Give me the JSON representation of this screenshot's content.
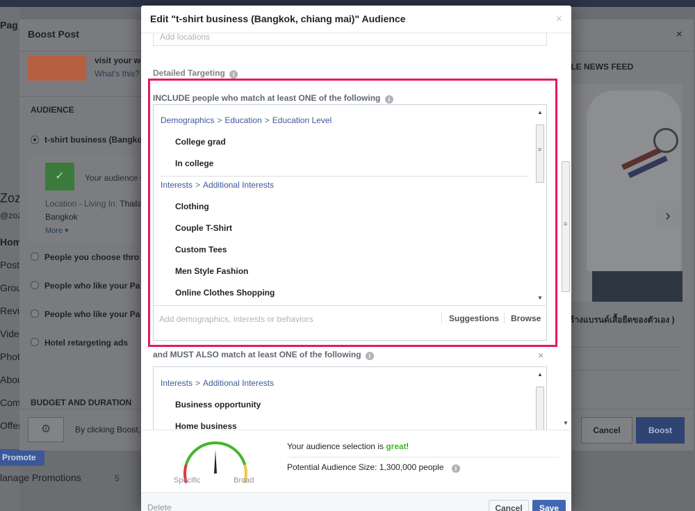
{
  "background": {
    "left_labels": [
      "Pag",
      "Zoza",
      "@zoz",
      "Hom",
      "Posts",
      "Grou",
      "Revie",
      "Video",
      "Photo",
      "Abou",
      "Comm",
      "Offer"
    ],
    "promote_label": "Promote",
    "manage_label": "lanage Promotions",
    "manage_count": "5"
  },
  "boost_post": {
    "title": "Boost Post",
    "close_icon": "×",
    "visit_text": "visit your we",
    "what_text": "What's this?",
    "audience_heading": "AUDIENCE",
    "options": [
      {
        "label": "t-shirt business (Bangko",
        "selected": true
      },
      {
        "label": "People you choose thro",
        "selected": false
      },
      {
        "label": "People who like your Pa",
        "selected": false
      },
      {
        "label": "People who like your Pa",
        "selected": false
      },
      {
        "label": "Hotel retargeting ads",
        "selected": false
      }
    ],
    "audience_status": "Your audience s",
    "location_label": "Location - Living In:",
    "location_value": "Thaila",
    "location_city": "Bangkok",
    "more_label": "More ▾",
    "budget_heading": "BUDGET AND DURATION",
    "footer_text": "By clicking Boost,",
    "cancel_label": "Cancel",
    "boost_label": "Boost",
    "feed_label": "ILE NEWS FEED",
    "feed_caption": "ร้างแบรนด์เสื้อยืดของตัวเอง )"
  },
  "modal": {
    "title": "Edit \"t-shirt business (Bangkok, chiang mai)\" Audience",
    "close_icon": "×",
    "locations_placeholder": "Add locations",
    "detailed_targeting_label": "Detailed Targeting",
    "include_label": "INCLUDE people who match at least ONE of the following",
    "include_groups": [
      {
        "path": [
          "Demographics",
          "Education",
          "Education Level"
        ],
        "items": [
          "College grad",
          "In college"
        ]
      },
      {
        "path": [
          "Interests",
          "Additional Interests"
        ],
        "items": [
          "Clothing",
          "Couple T-Shirt",
          "Custom Tees",
          "Men Style Fashion",
          "Online Clothes Shopping"
        ]
      }
    ],
    "add_placeholder": "Add demographics, interests or behaviors",
    "suggestions_label": "Suggestions",
    "browse_label": "Browse",
    "must_label": "and MUST ALSO match at least ONE of the following",
    "must_close_icon": "×",
    "must_groups": [
      {
        "path": [
          "Interests",
          "Additional Interests"
        ],
        "items": [
          "Business opportunity",
          "Home business"
        ]
      }
    ],
    "meter": {
      "specific_label": "Specific",
      "broad_label": "Broad",
      "selection_prefix": "Your audience selection is ",
      "selection_value": "great",
      "selection_suffix": "!",
      "potential_label": "Potential Audience Size: 1,300,000 people",
      "needle_fraction": 0.5,
      "colors": {
        "red": "#e3383b",
        "green": "#42b72a",
        "yellow": "#f7c349"
      }
    },
    "delete_label": "Delete",
    "cancel_label": "Cancel",
    "save_label": "Save"
  },
  "icons": [
    "info-icon",
    "close-icon",
    "gear-icon",
    "chevron-right-icon",
    "check-icon",
    "scroll-up-icon",
    "scroll-down-icon"
  ]
}
